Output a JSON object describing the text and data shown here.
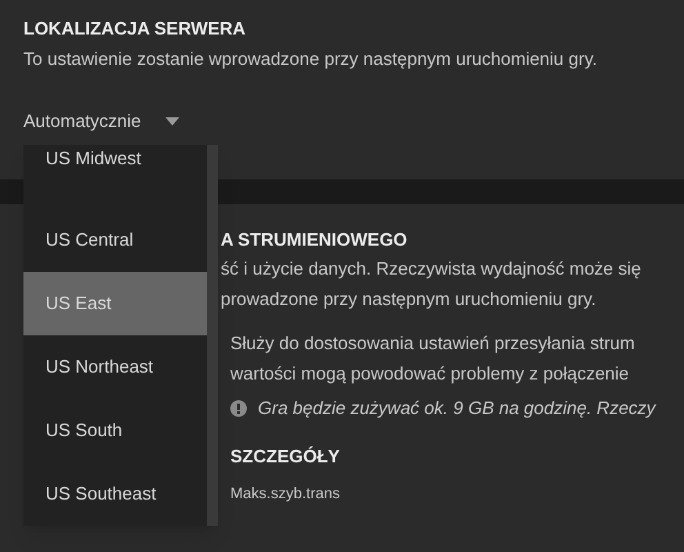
{
  "server_location": {
    "title": "LOKALIZACJA SERWERA",
    "description": "To ustawienie zostanie wprowadzone przy następnym uruchomieniu gry.",
    "select": {
      "value": "Automatycznie",
      "expanded": true,
      "options": [
        {
          "label": "US Midwest",
          "selected": false
        },
        {
          "label": "US Central",
          "selected": false
        },
        {
          "label": "US East",
          "selected": true
        },
        {
          "label": "US Northeast",
          "selected": false
        },
        {
          "label": "US South",
          "selected": false
        },
        {
          "label": "US Southeast",
          "selected": false
        }
      ]
    }
  },
  "streaming": {
    "title": "A STRUMIENIOWEGO",
    "description_lines": [
      "ść i użycie danych. Rzeczywista wydajność może się",
      "prowadzone przy następnym uruchomieniu gry."
    ],
    "hint_lines": [
      "Służy do dostosowania ustawień przesyłania strum",
      "wartości mogą powodować problemy z połączenie"
    ],
    "notice": "Gra będzie zużywać ok. 9 GB na godzinę. Rzeczy",
    "details_title": "SZCZEGÓŁY",
    "details_label": "Maks.szyb.trans"
  }
}
